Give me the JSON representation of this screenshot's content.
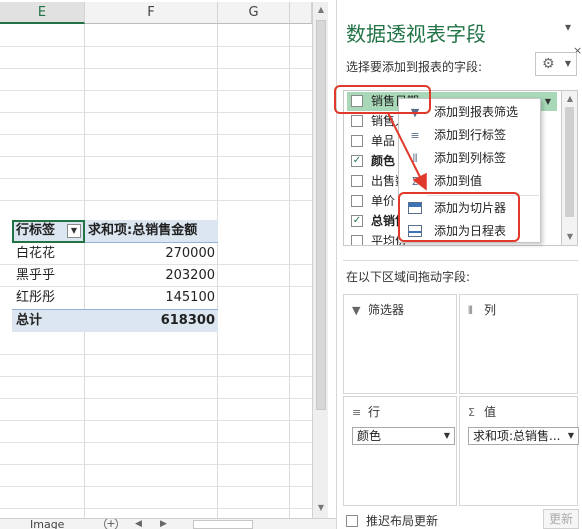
{
  "sheet": {
    "columns": [
      "E",
      "F",
      "G"
    ],
    "pivot_table": {
      "header_label": "行标签",
      "value_header": "求和项:总销售金额",
      "rows": [
        {
          "label": "白花花",
          "value": "270000"
        },
        {
          "label": "黑乎乎",
          "value": "203200"
        },
        {
          "label": "红彤彤",
          "value": "145100"
        }
      ],
      "total_label": "总计",
      "total_value": "618300"
    },
    "sheet_tab": "Image",
    "add_sheet_symbol": "+"
  },
  "pane": {
    "title": "数据透视表字段",
    "subtitle": "选择要添加到报表的字段:",
    "close_symbol": "×",
    "fields": [
      {
        "label": "销售日期",
        "checked": false,
        "highlighted": true
      },
      {
        "label": "销售人",
        "checked": false
      },
      {
        "label": "单品",
        "checked": false
      },
      {
        "label": "颜色",
        "checked": true
      },
      {
        "label": "出售数",
        "checked": false
      },
      {
        "label": "单价",
        "checked": false
      },
      {
        "label": "总销售",
        "checked": true
      },
      {
        "label": "平均价",
        "checked": false
      }
    ],
    "drag_hint": "在以下区域间拖动字段:",
    "areas": {
      "filters": {
        "label": "筛选器"
      },
      "columns": {
        "label": "列"
      },
      "rows": {
        "label": "行",
        "item": "颜色"
      },
      "values": {
        "label": "值",
        "item": "求和项:总销售..."
      }
    },
    "defer_label": "推迟布局更新",
    "update_label": "更新"
  },
  "context_menu": {
    "items": [
      {
        "label": "添加到报表筛选",
        "icon": "filter-icon"
      },
      {
        "label": "添加到行标签",
        "icon": "rows-icon"
      },
      {
        "label": "添加到列标签",
        "icon": "columns-icon"
      },
      {
        "label": "添加到值",
        "icon": "sigma-icon"
      },
      {
        "label": "添加为切片器",
        "icon": "slicer-icon"
      },
      {
        "label": "添加为日程表",
        "icon": "timeline-icon"
      }
    ]
  },
  "colors": {
    "accent_green": "#217346",
    "pivot_band": "#dce6f1",
    "field_highlight": "#a8d8b7",
    "annotation_red": "#e0392b"
  }
}
